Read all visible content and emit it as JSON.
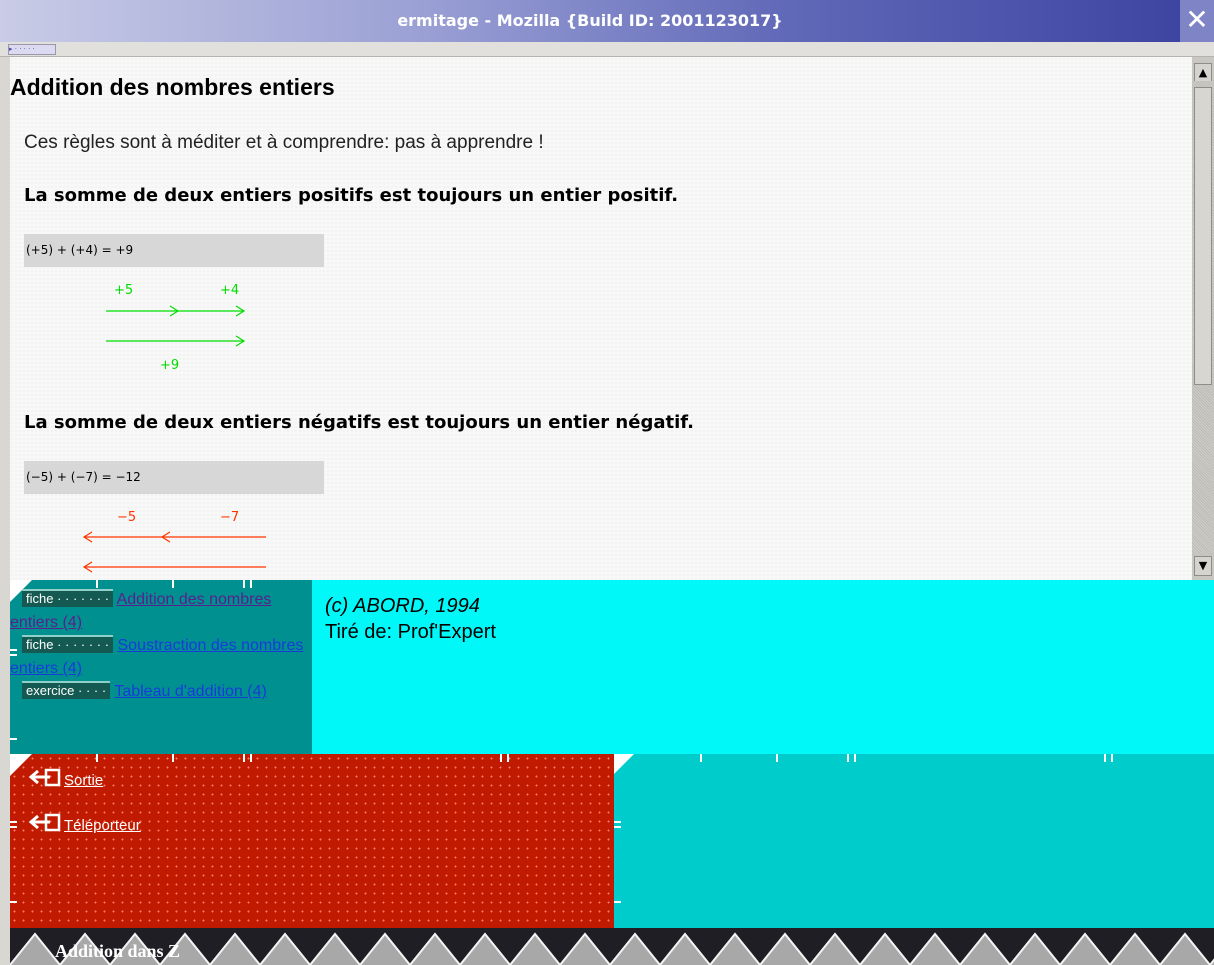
{
  "window": {
    "title": "ermitage - Mozilla {Build ID: 2001123017}",
    "close_glyph": "✕"
  },
  "content": {
    "heading": "Addition des nombres entiers",
    "intro": "Ces règles sont à méditer et à comprendre: pas à apprendre !",
    "rules": [
      {
        "statement": "La somme de deux entiers positifs est toujours un entier positif.",
        "equation": "(+5) + (+4) = +9",
        "color": "#00dd00",
        "labels": [
          "+5",
          "+4",
          "+9"
        ]
      },
      {
        "statement": "La somme de deux entiers négatifs est toujours un entier négatif.",
        "equation": "(−5) + (−7) = −12",
        "color": "#ff3300",
        "labels": [
          "−5",
          "−7"
        ]
      }
    ]
  },
  "nav": {
    "items": [
      {
        "tag": "fiche · · · · · · ·",
        "link": "Addition des nombres entiers (4)",
        "visited": true
      },
      {
        "tag": "fiche · · · · · · ·",
        "link": "Soustraction des nombres entiers (4)",
        "visited": false
      },
      {
        "tag": "exercice · · · ·",
        "link": "Tableau d'addition (4)",
        "visited": false
      }
    ]
  },
  "credit": {
    "line1": "(c) ABORD, 1994",
    "line2": "Tiré de: Prof'Expert"
  },
  "exit": {
    "items": [
      "Sortie",
      "Téléporteur"
    ]
  },
  "footer": {
    "label": "Addition dans Z"
  },
  "colors": {
    "nav_bg": "#009090",
    "credit_bg": "#00f8f8",
    "exit_bg": "#c01a00",
    "teal_bg": "#00cccc"
  }
}
